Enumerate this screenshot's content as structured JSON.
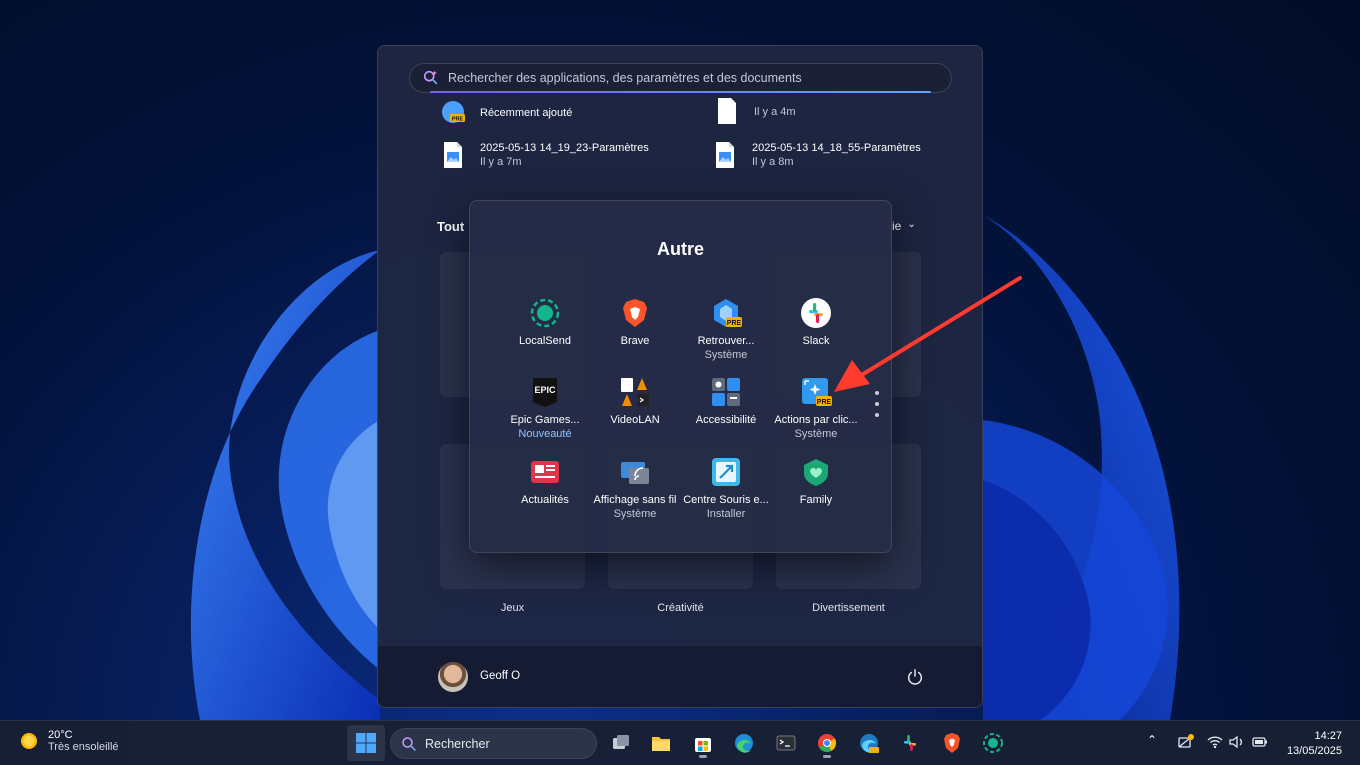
{
  "start_menu": {
    "search_placeholder": "Rechercher des applications, des paramètres et des documents",
    "recent": [
      {
        "title": "Récemment ajouté",
        "time": ""
      },
      {
        "title": "",
        "time": "Il y a 4m"
      },
      {
        "title": "2025-05-13 14_19_23-Paramètres",
        "time": "Il y a 7m"
      },
      {
        "title": "2025-05-13 14_18_55-Paramètres",
        "time": "Il y a 8m"
      }
    ],
    "all_label": "Tout",
    "category_label_partial": "rie",
    "categories": [
      "Jeux",
      "Créativité",
      "Divertissement"
    ],
    "user_name": "Geoff O"
  },
  "folder": {
    "title": "Autre",
    "apps": [
      {
        "name": "LocalSend",
        "sub": ""
      },
      {
        "name": "Brave",
        "sub": ""
      },
      {
        "name": "Retrouver...",
        "sub": "Système"
      },
      {
        "name": "Slack",
        "sub": ""
      },
      {
        "name": "Epic Games...",
        "sub": "Nouveauté"
      },
      {
        "name": "VideoLAN",
        "sub": ""
      },
      {
        "name": "Accessibilité",
        "sub": ""
      },
      {
        "name": "Actions par clic...",
        "sub": "Système"
      },
      {
        "name": "Actualités",
        "sub": ""
      },
      {
        "name": "Affichage sans fil",
        "sub": "Système"
      },
      {
        "name": "Centre Souris e...",
        "sub": "Installer"
      },
      {
        "name": "Family",
        "sub": ""
      }
    ],
    "pre_badge": "PRE",
    "epic_logo": "EPIC"
  },
  "taskbar": {
    "weather_temp": "20°C",
    "weather_condition": "Très ensoleillé",
    "search_label": "Rechercher",
    "time": "14:27",
    "date": "13/05/2025"
  },
  "colors": {
    "accent": "#4da3ff",
    "arrow": "#ff3b2f",
    "brave": "#fb542b"
  }
}
